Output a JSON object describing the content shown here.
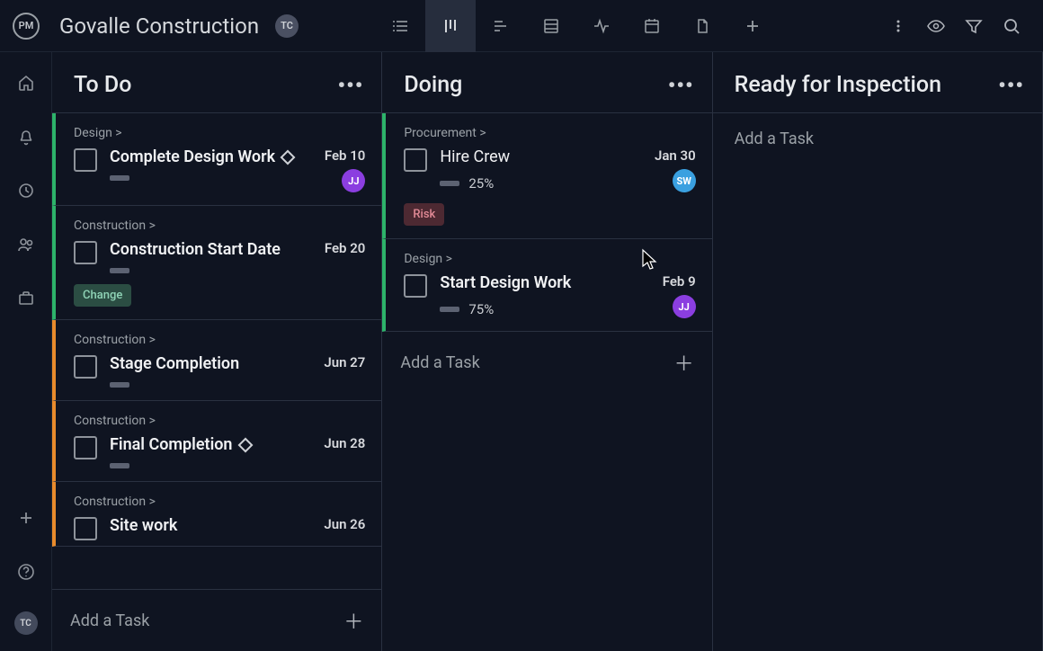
{
  "app": {
    "logo_text": "PM",
    "project_title": "Govalle Construction",
    "user_initials": "TC"
  },
  "sidebar_user": "TC",
  "columns": [
    {
      "title": "To Do",
      "add_label": "Add a Task",
      "cards": [
        {
          "breadcrumb": "Design >",
          "title": "Complete Design Work",
          "milestone": true,
          "date": "Feb 10",
          "avatar": {
            "text": "JJ",
            "color": "purple"
          },
          "border": "green"
        },
        {
          "breadcrumb": "Construction >",
          "title": "Construction Start Date",
          "date": "Feb 20",
          "tag": {
            "text": "Change",
            "kind": "change"
          },
          "border": "green"
        },
        {
          "breadcrumb": "Construction >",
          "title": "Stage Completion",
          "date": "Jun 27",
          "border": "orange"
        },
        {
          "breadcrumb": "Construction >",
          "title": "Final Completion",
          "milestone": true,
          "date": "Jun 28",
          "border": "orange"
        },
        {
          "breadcrumb": "Construction >",
          "title": "Site work",
          "date": "Jun 26",
          "border": "orange"
        }
      ]
    },
    {
      "title": "Doing",
      "add_label": "Add a Task",
      "cards": [
        {
          "breadcrumb": "Procurement >",
          "title": "Hire Crew",
          "date": "Jan 30",
          "progress": "25%",
          "avatar": {
            "text": "SW",
            "color": "blue"
          },
          "tag": {
            "text": "Risk",
            "kind": "risk"
          },
          "border": "green"
        },
        {
          "breadcrumb": "Design >",
          "title": "Start Design Work",
          "date": "Feb 9",
          "progress": "75%",
          "avatar": {
            "text": "JJ",
            "color": "purple"
          },
          "border": "green"
        }
      ]
    },
    {
      "title": "Ready for Inspection",
      "add_label": "Add a Task",
      "cards": []
    }
  ]
}
